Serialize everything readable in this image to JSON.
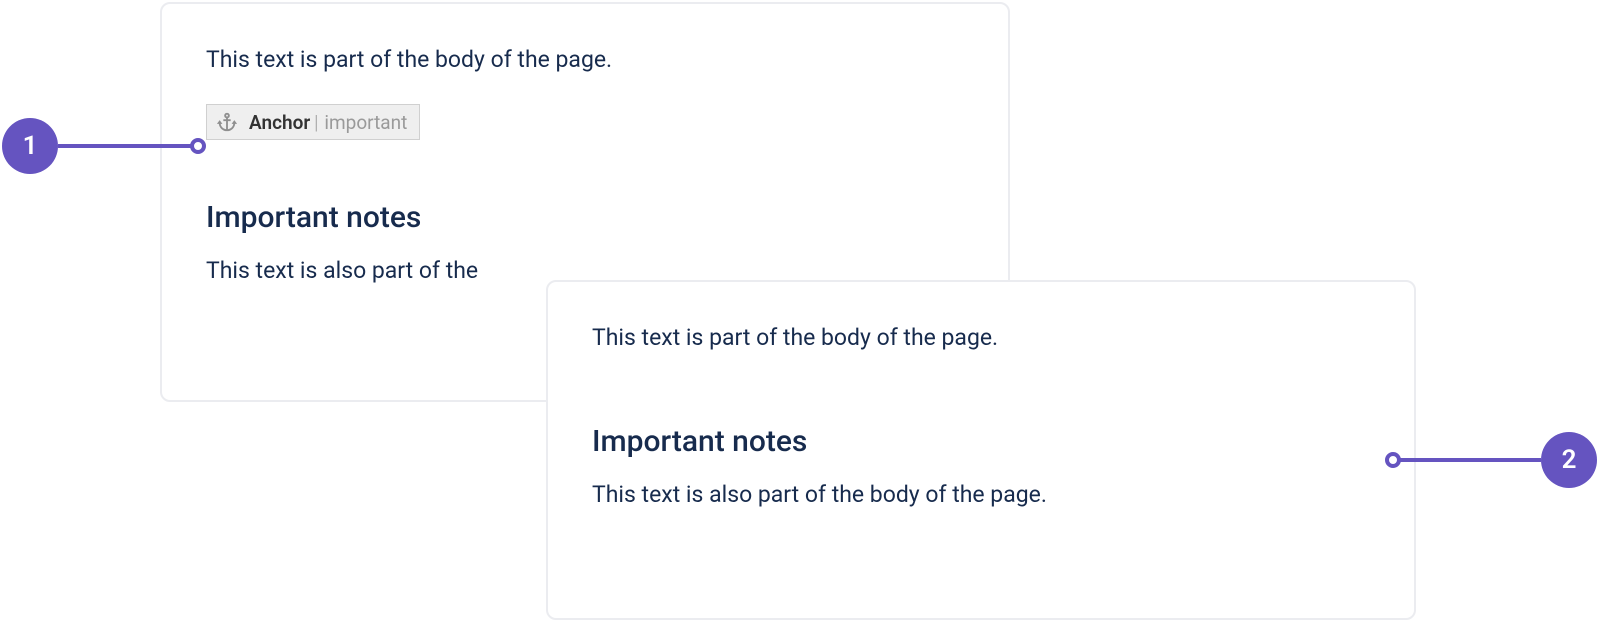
{
  "panel1": {
    "body_text_1": "This text is part of the body of the page.",
    "anchor": {
      "label": "Anchor",
      "separator": "|",
      "value": "important"
    },
    "heading": "Important notes",
    "body_text_2": "This text is also part of the"
  },
  "panel2": {
    "body_text_1": "This text is part of the body of the page.",
    "heading": "Important notes",
    "body_text_2": "This text is also part of the body of the page."
  },
  "callouts": {
    "c1": "1",
    "c2": "2"
  }
}
